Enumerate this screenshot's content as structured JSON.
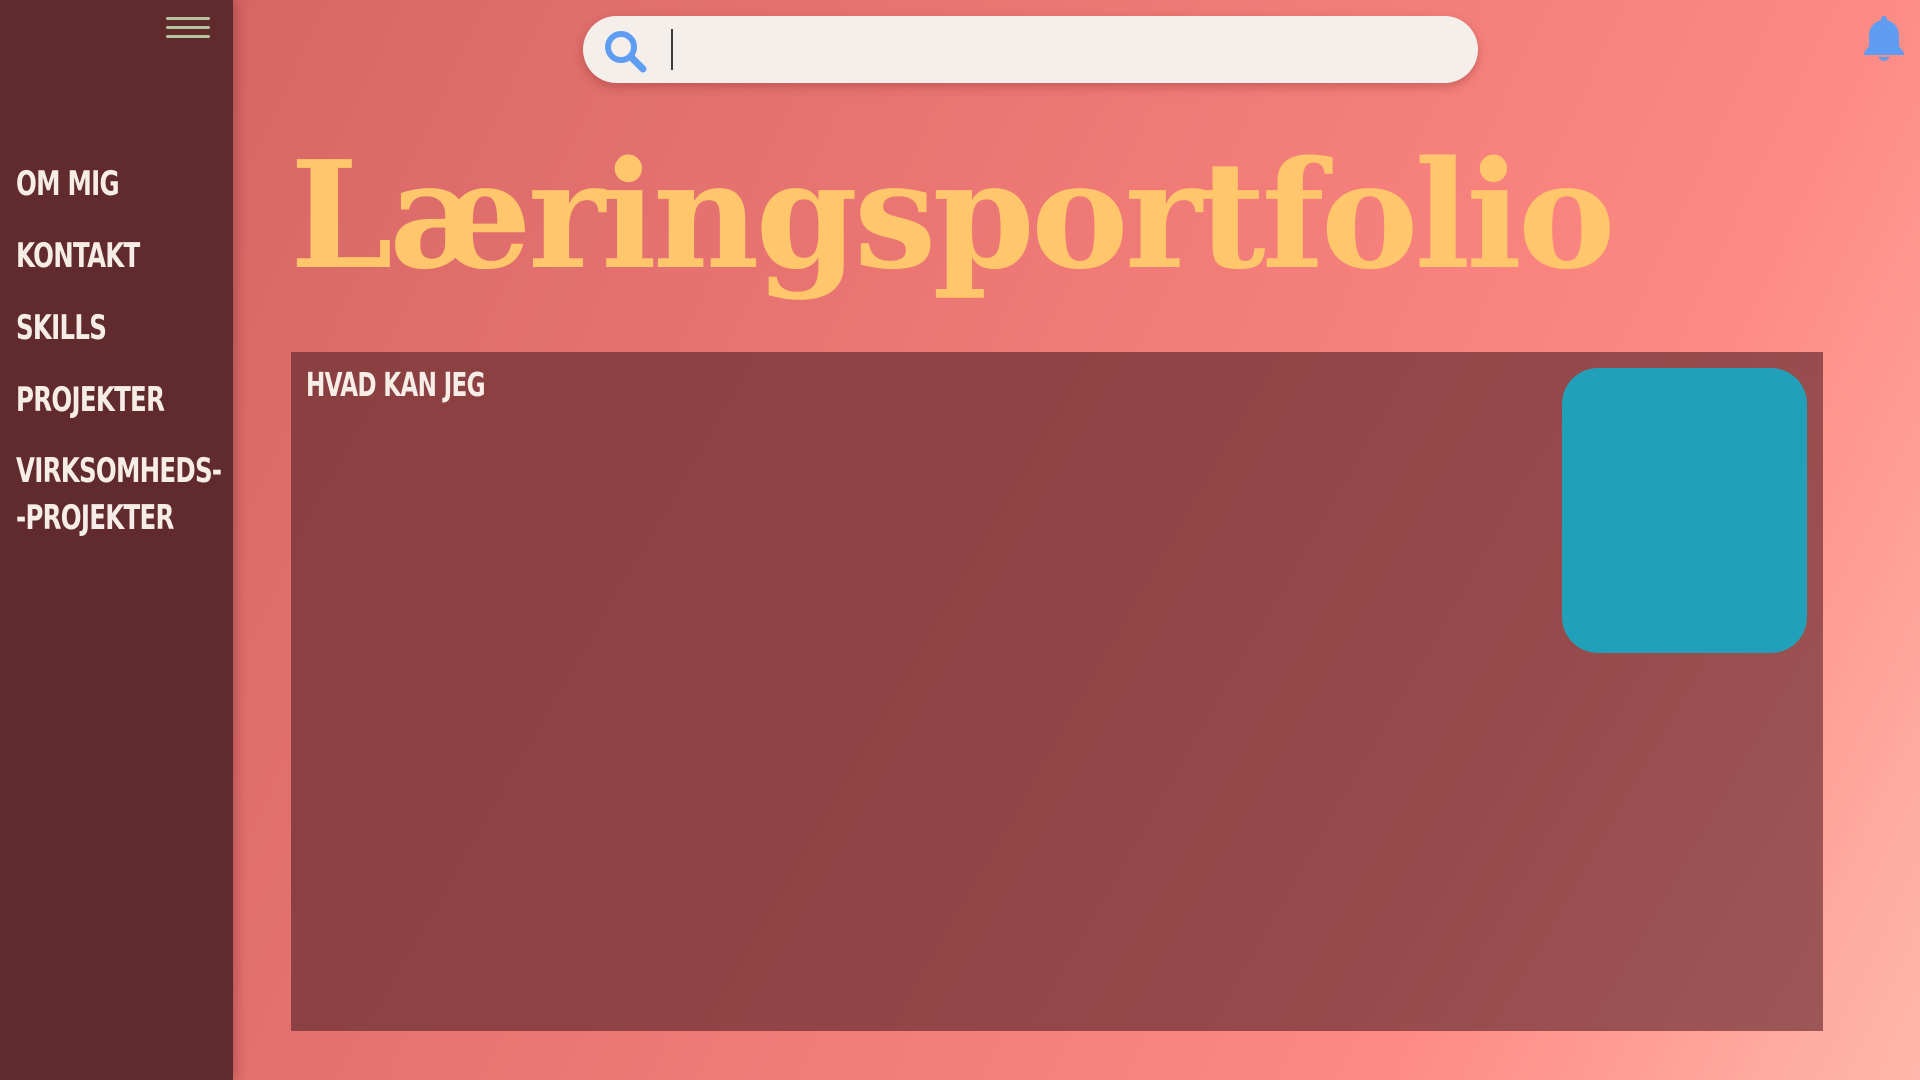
{
  "sidebar": {
    "menu_icon": "hamburger-menu-icon",
    "items": [
      {
        "label": "Om mig"
      },
      {
        "label": "Kontakt"
      },
      {
        "label": "Skills"
      },
      {
        "label": "Projekter"
      },
      {
        "label": "Virksomheds-\n-projekter"
      }
    ]
  },
  "search": {
    "icon": "search-icon",
    "value": "",
    "placeholder": ""
  },
  "header": {
    "notification_icon": "bell-icon"
  },
  "page": {
    "title": "Læringsportfolio"
  },
  "panel": {
    "heading": "Hvad kan jeg"
  },
  "colors": {
    "sidebar_bg": "#612b2d",
    "title": "#ffc66b",
    "panel_bg": "#8f4344",
    "photo_placeholder": "#22a0b9",
    "search_icon": "#5f9df2",
    "bell_icon": "#5f9df2",
    "menu_icon": "#b5c49e"
  }
}
